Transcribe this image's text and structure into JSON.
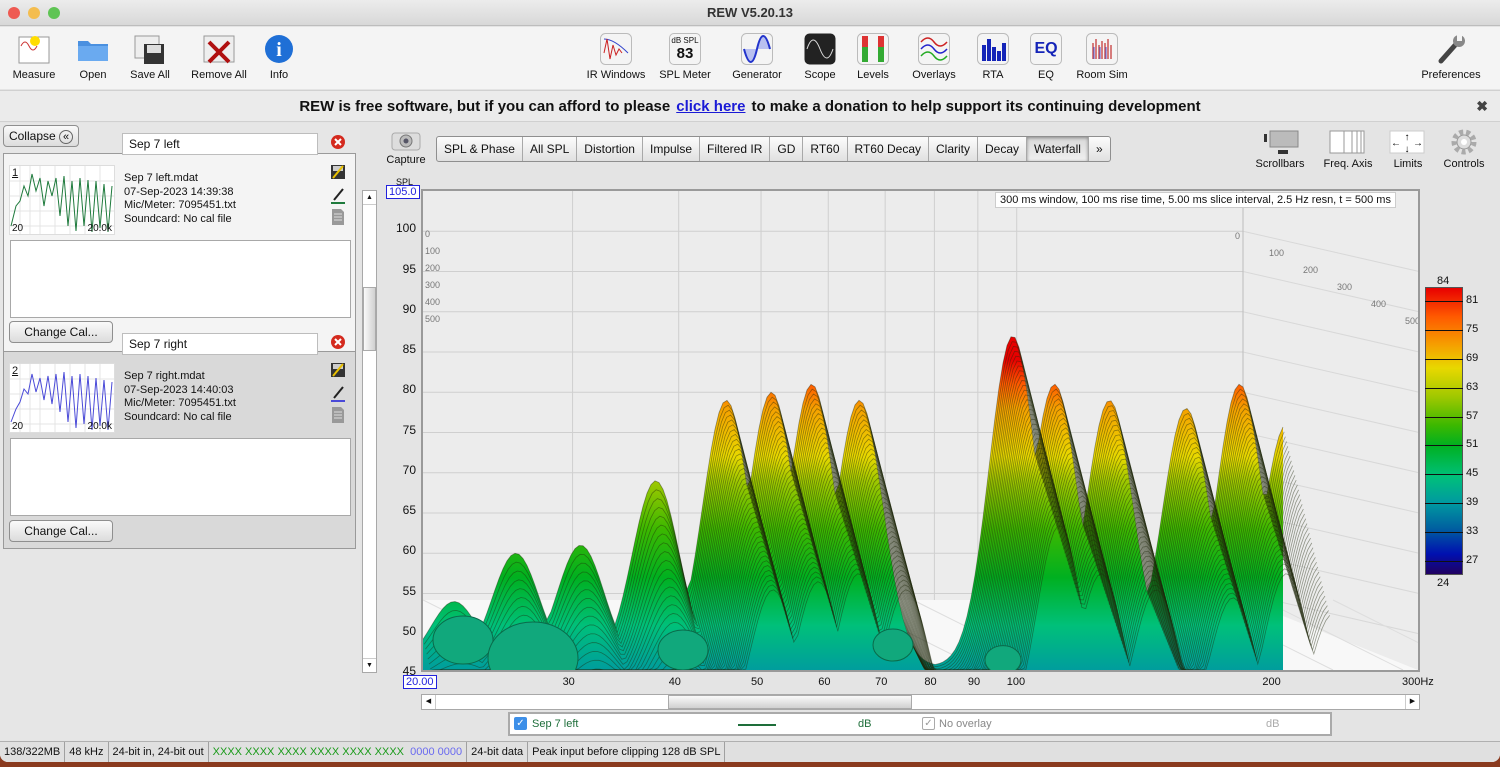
{
  "window": {
    "title": "REW V5.20.13"
  },
  "toolbar": {
    "left": [
      {
        "id": "measure",
        "label": "Measure",
        "icon": "measure-icon"
      },
      {
        "id": "open",
        "label": "Open",
        "icon": "folder-icon"
      },
      {
        "id": "save-all",
        "label": "Save All",
        "icon": "floppy-icon"
      },
      {
        "id": "remove-all",
        "label": "Remove All",
        "icon": "remove-x-icon"
      },
      {
        "id": "info",
        "label": "Info",
        "icon": "info-icon"
      }
    ],
    "center": [
      {
        "id": "ir-windows",
        "label": "IR Windows",
        "icon": "ir-windows-icon"
      },
      {
        "id": "spl-meter",
        "label": "SPL Meter",
        "icon": "spl-meter-icon",
        "icon_text_top": "dB SPL",
        "icon_text_value": "83"
      },
      {
        "id": "generator",
        "label": "Generator",
        "icon": "sine-wave-icon"
      },
      {
        "id": "scope",
        "label": "Scope",
        "icon": "scope-icon"
      },
      {
        "id": "levels",
        "label": "Levels",
        "icon": "levels-meter-icon"
      },
      {
        "id": "overlays",
        "label": "Overlays",
        "icon": "overlays-icon"
      },
      {
        "id": "rta",
        "label": "RTA",
        "icon": "rta-bars-icon"
      },
      {
        "id": "eq",
        "label": "EQ",
        "icon": "eq-icon",
        "icon_text": "EQ"
      },
      {
        "id": "room-sim",
        "label": "Room Sim",
        "icon": "room-sim-icon"
      }
    ],
    "preferences": {
      "label": "Preferences",
      "icon": "wrench-icon"
    }
  },
  "donate": {
    "before": "REW is free software, but if you can afford to please",
    "link": "click here",
    "after": "to make a donation to help support its continuing development",
    "close": "✖"
  },
  "left_panel": {
    "collapse_label": "Collapse",
    "collapse_icon": "«",
    "measurements": [
      {
        "index": "1",
        "name": "Sep 7 left",
        "file": "Sep 7 left.mdat",
        "date": "07-Sep-2023 14:39:38",
        "mic": "Mic/Meter: 7095451.txt",
        "soundcard": "Soundcard: No cal file",
        "thumb_min": "20",
        "thumb_max": "20.0k",
        "color": "#1e7a3c",
        "change_cal": "Change Cal..."
      },
      {
        "index": "2",
        "name": "Sep 7 right",
        "file": "Sep 7 right.mdat",
        "date": "07-Sep-2023 14:40:03",
        "mic": "Mic/Meter: 7095451.txt",
        "soundcard": "Soundcard: No cal file",
        "thumb_min": "20",
        "thumb_max": "20.0k",
        "color": "#4a4ad8",
        "change_cal": "Change Cal..."
      }
    ]
  },
  "capture": {
    "label": "Capture"
  },
  "tabs": [
    {
      "label": "SPL & Phase",
      "active": false
    },
    {
      "label": "All SPL",
      "active": false
    },
    {
      "label": "Distortion",
      "active": false
    },
    {
      "label": "Impulse",
      "active": false
    },
    {
      "label": "Filtered IR",
      "active": false
    },
    {
      "label": "GD",
      "active": false
    },
    {
      "label": "RT60",
      "active": false
    },
    {
      "label": "RT60 Decay",
      "active": false
    },
    {
      "label": "Clarity",
      "active": false
    },
    {
      "label": "Decay",
      "active": false
    },
    {
      "label": "Waterfall",
      "active": true
    },
    {
      "label": "»",
      "active": false
    }
  ],
  "right_tools": [
    {
      "label": "Scrollbars",
      "icon": "scrollbars-icon"
    },
    {
      "label": "Freq. Axis",
      "icon": "freq-axis-icon"
    },
    {
      "label": "Limits",
      "icon": "limits-arrows-icon"
    },
    {
      "label": "Controls",
      "icon": "gear-icon"
    }
  ],
  "chart_data": {
    "type": "waterfall",
    "title": "",
    "info": "300 ms window, 100 ms rise time, 5.00 ms slice interval, 2.5 Hz resn, t = 500 ms",
    "ylabel": "SPL",
    "ymax_field": "105.0",
    "xmin_field": "20.00",
    "xunit": "Hz",
    "ylim": [
      45,
      105
    ],
    "yticks": [
      "100",
      "95",
      "90",
      "85",
      "80",
      "75",
      "70",
      "65",
      "60",
      "55",
      "50",
      "45"
    ],
    "xlim": [
      20,
      300
    ],
    "xscale": "log",
    "xticks": [
      {
        "v": 30,
        "label": "30"
      },
      {
        "v": 40,
        "label": "40"
      },
      {
        "v": 50,
        "label": "50"
      },
      {
        "v": 60,
        "label": "60"
      },
      {
        "v": 70,
        "label": "70"
      },
      {
        "v": 80,
        "label": "80"
      },
      {
        "v": 90,
        "label": "90"
      },
      {
        "v": 100,
        "label": "100"
      },
      {
        "v": 200,
        "label": "200"
      },
      {
        "v": 300,
        "label": "300Hz"
      }
    ],
    "time_ticks_ms": [
      "0",
      "100",
      "200",
      "300",
      "400",
      "500"
    ],
    "colorbar": {
      "max": "84",
      "min": "24",
      "ticks": [
        "81",
        "75",
        "69",
        "63",
        "57",
        "51",
        "45",
        "39",
        "33",
        "27"
      ]
    },
    "front_slice_peaks": [
      {
        "freq": 22,
        "spl": 54
      },
      {
        "freq": 26,
        "spl": 60
      },
      {
        "freq": 31,
        "spl": 61
      },
      {
        "freq": 38,
        "spl": 69
      },
      {
        "freq": 46,
        "spl": 79
      },
      {
        "freq": 52,
        "spl": 80
      },
      {
        "freq": 58,
        "spl": 81
      },
      {
        "freq": 66,
        "spl": 79
      },
      {
        "freq": 100,
        "spl": 87
      },
      {
        "freq": 112,
        "spl": 81
      },
      {
        "freq": 130,
        "spl": 79
      },
      {
        "freq": 160,
        "spl": 78
      },
      {
        "freq": 185,
        "spl": 81
      },
      {
        "freq": 210,
        "spl": 76
      }
    ],
    "series": [
      {
        "name": "Sep 7 left",
        "unit": "dB"
      }
    ]
  },
  "legend": {
    "items": [
      {
        "label": "Sep 7 left",
        "unit": "dB",
        "checked": true,
        "color": "#1e6e3a"
      },
      {
        "label": "No overlay",
        "unit": "dB",
        "checked": true,
        "color": "#999999"
      }
    ]
  },
  "status": {
    "memory": "138/322MB",
    "rate": "48 kHz",
    "bits": "24-bit in, 24-bit out",
    "levels_green": "XXXX XXXX  XXXX XXXX  XXXX XXXX",
    "levels_blue": "0000 0000",
    "data": "24-bit data",
    "peak": "Peak input before clipping 128 dB SPL"
  }
}
